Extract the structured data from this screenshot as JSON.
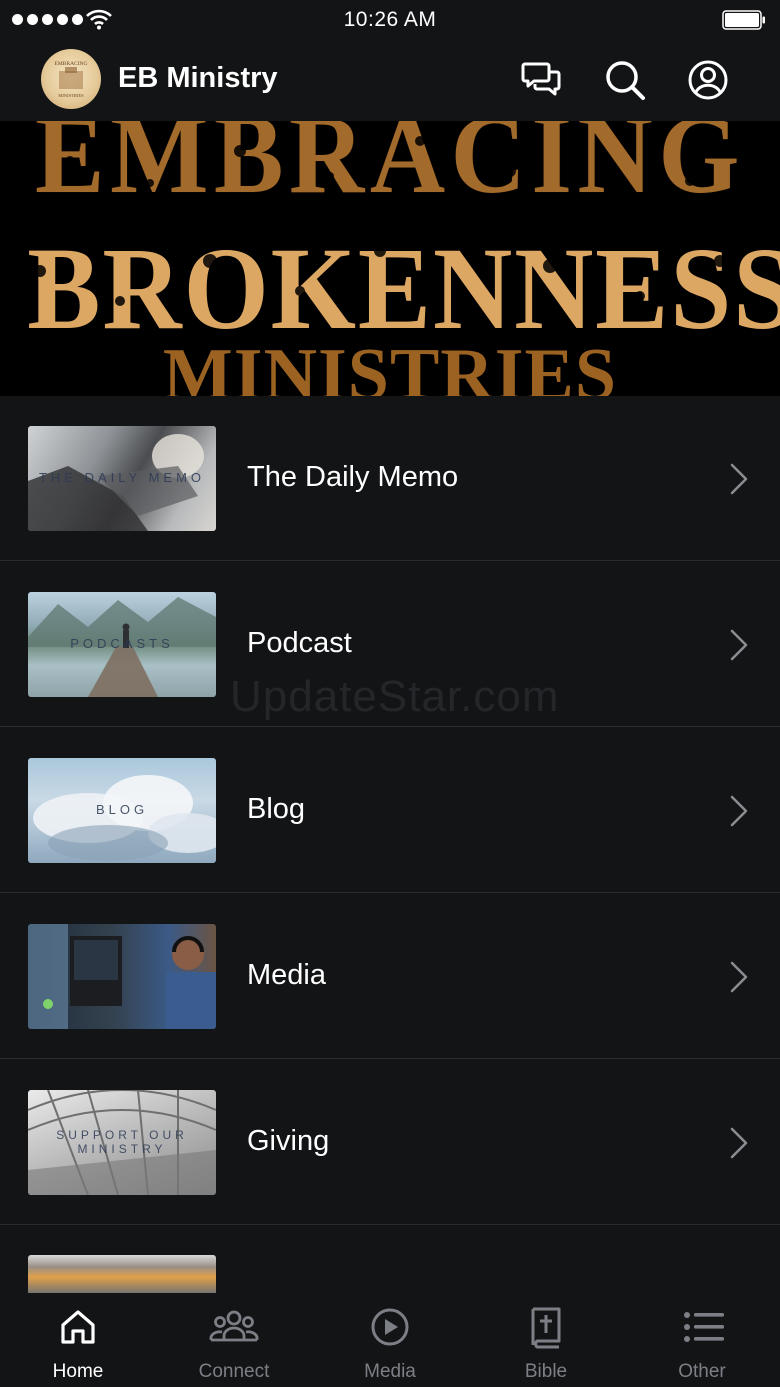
{
  "status_bar": {
    "time": "10:26 AM"
  },
  "header": {
    "app_name": "EB Ministry"
  },
  "banner": {
    "line1": "EMBRACING",
    "line2": "BROKENNESS",
    "line3": "MINISTRIES"
  },
  "avatar": {
    "logo_text_top": "EMBRACING",
    "logo_text_bottom": "MINISTRIES"
  },
  "items": [
    {
      "label": "The Daily Memo",
      "thumb_text": "THE DAILY MEMO"
    },
    {
      "label": "Podcast",
      "thumb_text": "PODCASTS"
    },
    {
      "label": "Blog",
      "thumb_text": "BLOG"
    },
    {
      "label": "Media",
      "thumb_text": ""
    },
    {
      "label": "Giving",
      "thumb_text": "SUPPORT OUR MINISTRY"
    }
  ],
  "watermark": "UpdateStar.com",
  "tabs": [
    {
      "label": "Home",
      "icon": "home-icon",
      "active": true
    },
    {
      "label": "Connect",
      "icon": "people-icon",
      "active": false
    },
    {
      "label": "Media",
      "icon": "play-icon",
      "active": false
    },
    {
      "label": "Bible",
      "icon": "bible-icon",
      "active": false
    },
    {
      "label": "Other",
      "icon": "list-icon",
      "active": false
    }
  ],
  "colors": {
    "background": "#131416",
    "divider": "#2a2b2e",
    "inactive_tab": "#7c7f85",
    "banner_gold": "#dca763",
    "banner_bronze": "#a36b2b"
  }
}
